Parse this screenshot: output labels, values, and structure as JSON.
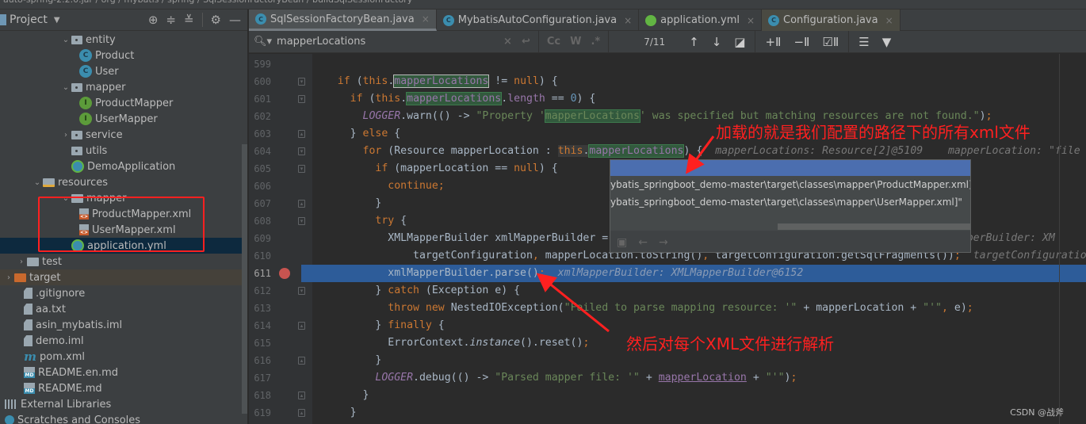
{
  "breadcrumb": [
    "auto-spring-2.2.0.jar",
    "org",
    "mybatis",
    "spring",
    "SqlSessionFactoryBean",
    "buildSqlSessionFactory"
  ],
  "project_panel": {
    "title": "Project",
    "tools": [
      "locate-icon",
      "expand-all-icon",
      "collapse-all-icon",
      "gear-icon",
      "hide-icon"
    ],
    "tree": [
      {
        "label": "entity",
        "type": "package",
        "depth": 3,
        "expanded": true
      },
      {
        "label": "Product",
        "type": "class",
        "depth": 4
      },
      {
        "label": "User",
        "type": "class",
        "depth": 4
      },
      {
        "label": "mapper",
        "type": "package",
        "depth": 3,
        "expanded": true
      },
      {
        "label": "ProductMapper",
        "type": "interface",
        "depth": 4
      },
      {
        "label": "UserMapper",
        "type": "interface",
        "depth": 4
      },
      {
        "label": "service",
        "type": "package",
        "depth": 3,
        "expanded": false
      },
      {
        "label": "utils",
        "type": "package",
        "depth": 3
      },
      {
        "label": "DemoApplication",
        "type": "spring-class",
        "depth": 3
      },
      {
        "label": "resources",
        "type": "resources-folder",
        "depth": 2,
        "expanded": true
      },
      {
        "label": "mapper",
        "type": "folder",
        "depth": 3,
        "expanded": true
      },
      {
        "label": "ProductMapper.xml",
        "type": "xml",
        "depth": 4
      },
      {
        "label": "UserMapper.xml",
        "type": "xml",
        "depth": 4
      },
      {
        "label": "application.yml",
        "type": "yml",
        "depth": 3,
        "selected": true
      },
      {
        "label": "test",
        "type": "folder",
        "depth": 1,
        "expanded": false
      },
      {
        "label": "target",
        "type": "excluded-folder",
        "depth": 0,
        "expanded": false,
        "highlighted": true
      },
      {
        "label": ".gitignore",
        "type": "file",
        "depth": 0
      },
      {
        "label": "aa.txt",
        "type": "file",
        "depth": 0
      },
      {
        "label": "asin_mybatis.iml",
        "type": "file",
        "depth": 0
      },
      {
        "label": "demo.iml",
        "type": "file",
        "depth": 0
      },
      {
        "label": "pom.xml",
        "type": "maven",
        "depth": 0
      },
      {
        "label": "README.en.md",
        "type": "md",
        "depth": 0
      },
      {
        "label": "README.md",
        "type": "md",
        "depth": 0
      },
      {
        "label": "External Libraries",
        "type": "libraries",
        "depth": -1
      },
      {
        "label": "Scratches and Consoles",
        "type": "scratches",
        "depth": -1
      }
    ]
  },
  "tabs": [
    {
      "label": "SqlSessionFactoryBean.java",
      "icon": "class-icon",
      "active": true
    },
    {
      "label": "MybatisAutoConfiguration.java",
      "icon": "class-icon"
    },
    {
      "label": "application.yml",
      "icon": "yml-icon"
    },
    {
      "label": "Configuration.java",
      "icon": "class-icon",
      "tinted": true
    }
  ],
  "find_bar": {
    "query": "mapperLocations",
    "match_count": "7/11",
    "options": [
      "Cc",
      "W",
      ".*"
    ]
  },
  "code": {
    "lines": [
      {
        "n": "599",
        "html": ""
      },
      {
        "n": "600",
        "html": "    <span class=\"kw\">if</span> (<span class=\"kw\">this</span>.<span class=\"fld mcur\">mapperLocations</span> != <span class=\"kw\">null</span>) {"
      },
      {
        "n": "601",
        "html": "      <span class=\"kw\">if</span> (<span class=\"kw\">this</span>.<span class=\"fld mhl\">mapperLocations</span>.<span class=\"fld\">length</span> == <span style=\"color:#6897bb\">0</span>) {"
      },
      {
        "n": "602",
        "html": "        <span class=\"fld it\">LOGGER</span>.warn(() -&gt; <span class=\"str\">\"Property '<span class=\"mhl\">mapperLocations</span>' was specified but matching resources are not found.\"</span>)<span class=\"kw\">;</span>"
      },
      {
        "n": "603",
        "html": "      } <span class=\"kw\">else</span> {"
      },
      {
        "n": "604",
        "html": "        <span class=\"kw\">for</span> (Resource mapperLocation : <span class=\"kw\" style=\"background:#3a3a3a\">this</span><span style=\"background:#3a3a3a\">.</span><span class=\"fld mhl\">mapperLocations</span>) {  <span class=\"hint\">mapperLocations: Resource[2]@5109    mapperLocation: \"file</span>"
      },
      {
        "n": "605",
        "html": "          <span class=\"kw\">if</span> (mapperLocation == <span class=\"kw\">null</span>) {"
      },
      {
        "n": "606",
        "html": "            <span class=\"kw\">continue;</span>"
      },
      {
        "n": "607",
        "html": "          }"
      },
      {
        "n": "608",
        "html": "          <span class=\"kw\">try</span> {"
      },
      {
        "n": "609",
        "html": "            XMLMapperBuilder xmlMapperBuilder =                                                   <span class=\"hint\">xmlMapperBuilder: XM</span>"
      },
      {
        "n": "610",
        "html": "                targetConfiguration<span class=\"kw\">,</span> mapperLocation.toString()<span class=\"kw\">,</span> targetConfiguration.getSqlFragments())<span class=\"kw\">;</span>  <span class=\"hint\">targetConfiguratio</span>"
      },
      {
        "n": "611",
        "html": "            xmlMapperBuilder.parse()<span class=\"kw\">;</span>  <span class=\"hint\" style=\"color:#8a9bb5\">xmlMapperBuilder: XMLMapperBuilder@6152</span>",
        "exec": true
      },
      {
        "n": "612",
        "html": "          } <span class=\"kw\">catch</span> (Exception e) {"
      },
      {
        "n": "613",
        "html": "            <span class=\"kw\">throw new</span> NestedIOException(<span class=\"str\">\"Failed to parse mapping resource: '\"</span> + mapperLocation + <span class=\"str\">\"'\"</span><span class=\"kw\">,</span> e)<span class=\"kw\">;</span>"
      },
      {
        "n": "614",
        "html": "          } <span class=\"kw\">finally</span> {"
      },
      {
        "n": "615",
        "html": "            ErrorContext.<span class=\"it\">instance</span>().reset()<span class=\"kw\">;</span>"
      },
      {
        "n": "616",
        "html": "          }"
      },
      {
        "n": "617",
        "html": "          <span class=\"fld it\">LOGGER</span>.debug(() -&gt; <span class=\"str\">\"Parsed mapper file: '\"</span> + <span class=\"ul\">mapperLocation</span> + <span class=\"str\">\"'\"</span>)<span class=\"kw\">;</span>"
      },
      {
        "n": "618",
        "html": "        }"
      },
      {
        "n": "619",
        "html": "      }"
      }
    ],
    "breakpoint_line": "611"
  },
  "debug_popup": {
    "items": [
      "ybatis_springboot_demo-master\\target\\classes\\mapper\\ProductMapper.xml]\"",
      "ybatis_springboot_demo-master\\target\\classes\\mapper\\UserMapper.xml]\""
    ]
  },
  "annotations": {
    "top": "加载的就是我们配置的路径下的所有xml文件",
    "bottom": "然后对每个XML文件进行解析",
    "color": "#ff2020"
  },
  "watermark": "CSDN @战斧"
}
